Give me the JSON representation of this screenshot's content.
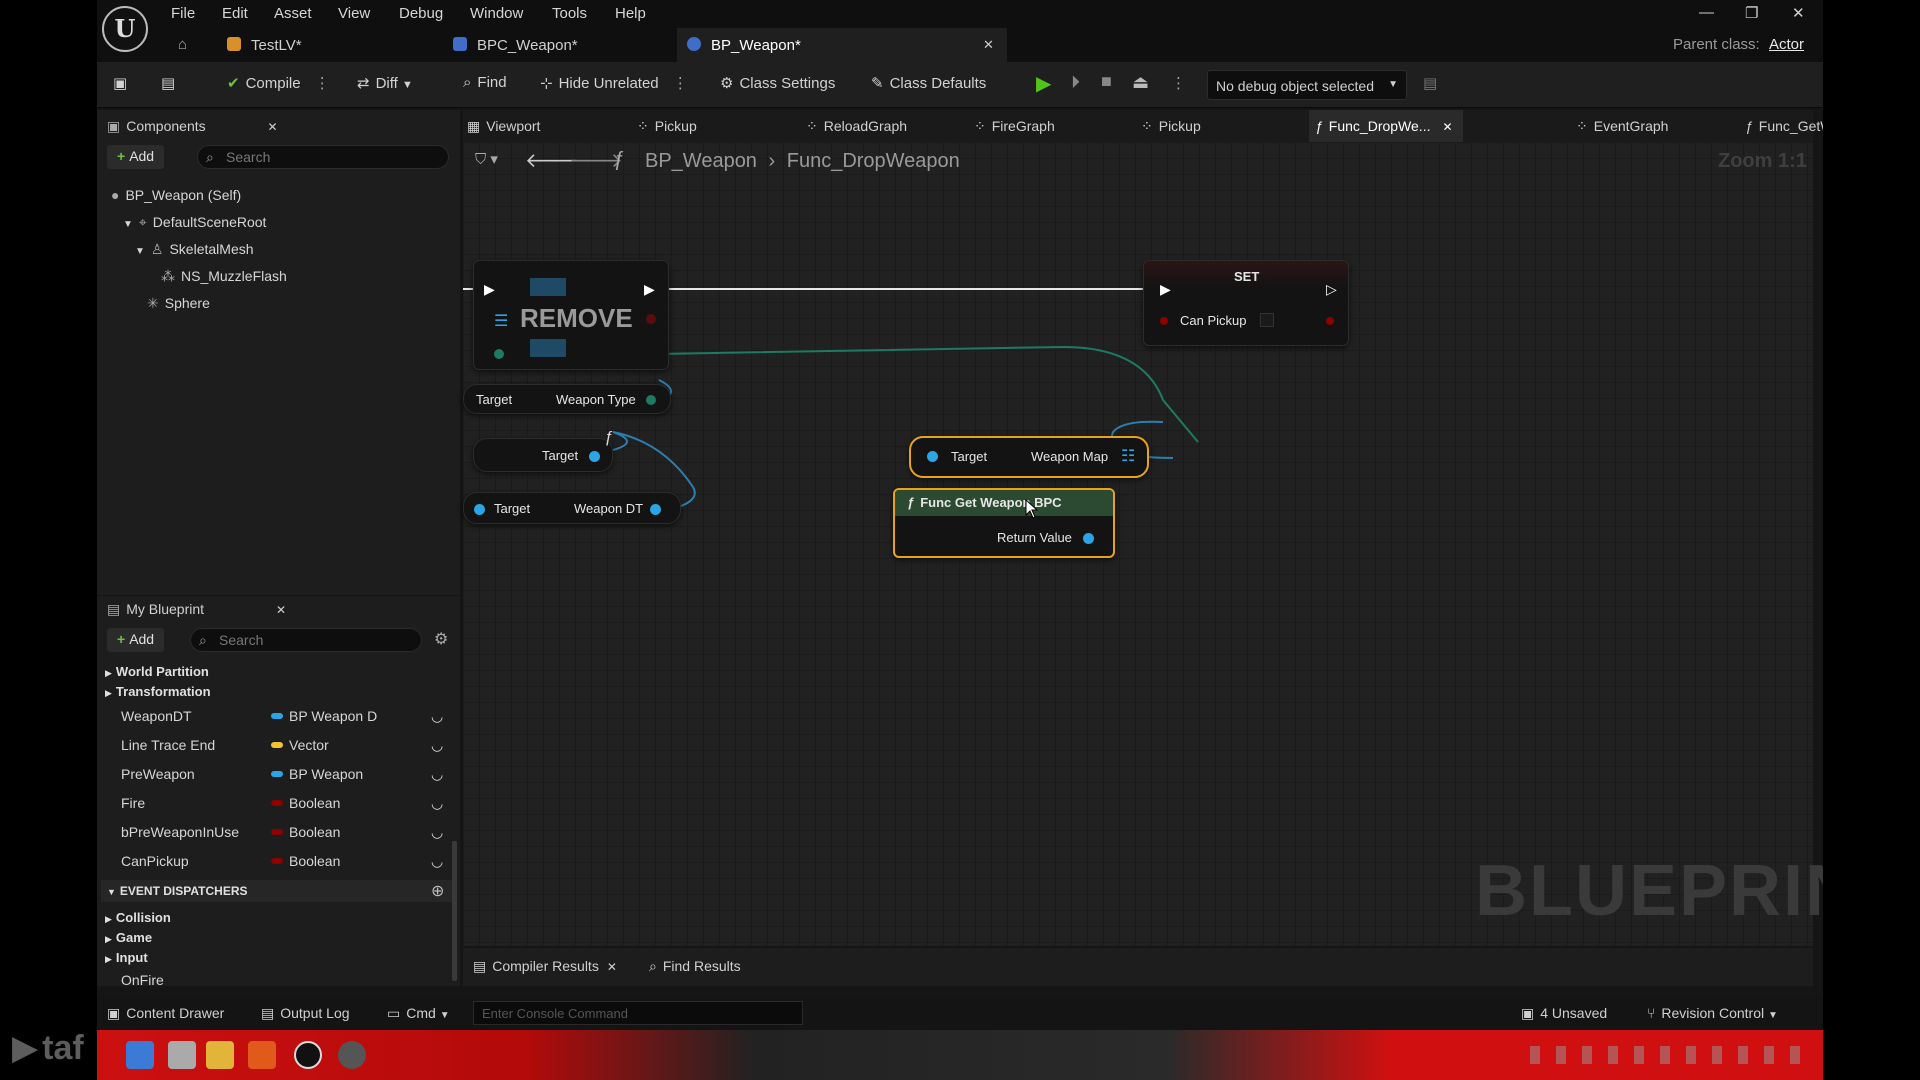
{
  "menu": [
    "File",
    "Edit",
    "Asset",
    "View",
    "Debug",
    "Window",
    "Tools",
    "Help"
  ],
  "doc_tabs": [
    {
      "label": "TestLV*"
    },
    {
      "label": "BPC_Weapon*"
    },
    {
      "label": "BP_Weapon*"
    }
  ],
  "parent_class": {
    "label": "Parent class:",
    "value": "Actor"
  },
  "toolbar": {
    "compile": "Compile",
    "diff": "Diff",
    "find": "Find",
    "hide_unrelated": "Hide Unrelated",
    "class_settings": "Class Settings",
    "class_defaults": "Class Defaults",
    "debug_object": "No debug object selected"
  },
  "components": {
    "title": "Components",
    "add": "Add",
    "search_placeholder": "Search",
    "tree": [
      "BP_Weapon (Self)",
      "DefaultSceneRoot",
      "SkeletalMesh",
      "NS_MuzzleFlash",
      "Sphere"
    ]
  },
  "my_blueprint": {
    "title": "My Blueprint",
    "add": "Add",
    "search_placeholder": "Search",
    "categories_top": [
      "World Partition",
      "Transformation"
    ],
    "variables": [
      {
        "name": "WeaponDT",
        "type": "BP Weapon D",
        "color": "#2aa6e6"
      },
      {
        "name": "Line Trace End",
        "type": "Vector",
        "color": "#f4c430"
      },
      {
        "name": "PreWeapon",
        "type": "BP Weapon",
        "color": "#2aa6e6"
      },
      {
        "name": "Fire",
        "type": "Boolean",
        "color": "#8c0000"
      },
      {
        "name": "bPreWeaponInUse",
        "type": "Boolean",
        "color": "#8c0000"
      },
      {
        "name": "CanPickup",
        "type": "Boolean",
        "color": "#8c0000"
      }
    ],
    "event_dispatchers": "EVENT DISPATCHERS",
    "categories_bottom": [
      "Collision",
      "Game",
      "Input",
      "OnFire"
    ]
  },
  "graph_tabs": [
    "Viewport",
    "Pickup",
    "ReloadGraph",
    "FireGraph",
    "Pickup",
    "Func_DropWe...",
    "EventGraph",
    "Func_GetWea..."
  ],
  "breadcrumb": {
    "bp": "BP_Weapon",
    "func": "Func_DropWeapon"
  },
  "zoom": "Zoom 1:1",
  "nodes": {
    "remove": "REMOVE",
    "set": "SET",
    "can_pickup": "Can Pickup",
    "target": "Target",
    "weapon_type": "Weapon Type",
    "weapon_map": "Weapon Map",
    "weapon_dt": "Weapon DT",
    "func_get": "Func Get Weapon BPC",
    "return_value": "Return Value"
  },
  "watermark": "BLUEPRINT",
  "bottom_tabs": {
    "compiler_results": "Compiler Results",
    "find_results": "Find Results"
  },
  "status_bar": {
    "content_drawer": "Content Drawer",
    "output_log": "Output Log",
    "cmd": "Cmd",
    "console_placeholder": "Enter Console Command",
    "unsaved": "4 Unsaved",
    "revision_control": "Revision Control"
  },
  "overlay_text": "taf"
}
